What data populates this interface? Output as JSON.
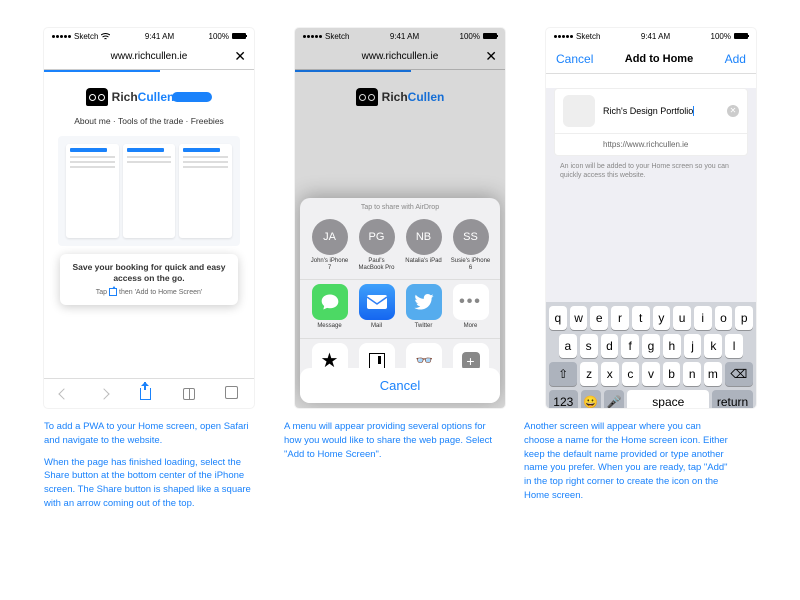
{
  "status": {
    "carrier": "Sketch",
    "time": "9:41 AM",
    "battery": "100%"
  },
  "url": "www.richcullen.ie",
  "phone1": {
    "logo_rich": "Rich",
    "logo_cullen": "Cullen",
    "nav": "About me · Tools of the trade · Freebies",
    "tooltip_title": "Save your booking for quick and easy access on the go.",
    "tooltip_sub_pre": "Tap",
    "tooltip_sub_post": "then 'Add to Home Screen'"
  },
  "phone2": {
    "airdrop": "Tap to share with AirDrop",
    "contacts": [
      {
        "initials": "JA",
        "name": "John's iPhone 7"
      },
      {
        "initials": "PG",
        "name": "Paul's MacBook Pro"
      },
      {
        "initials": "NB",
        "name": "Natalia's iPad"
      },
      {
        "initials": "SS",
        "name": "Susie's iPhone 6"
      }
    ],
    "apps": [
      {
        "label": "Message"
      },
      {
        "label": "Mail"
      },
      {
        "label": "Twitter"
      },
      {
        "label": "More"
      }
    ],
    "actions": [
      {
        "label": "Add to Favourites"
      },
      {
        "label": "Add Bookmark"
      },
      {
        "label": "Add to Reading List"
      },
      {
        "label": "Add to Home Screen"
      }
    ],
    "cancel": "Cancel"
  },
  "phone3": {
    "cancel": "Cancel",
    "title": "Add to Home",
    "add": "Add",
    "name_value": "Rich's Design Portfolio",
    "url_value": "https://www.richcullen.ie",
    "help": "An icon will be added to your Home screen so you can quickly access this website.",
    "keys_r1": [
      "q",
      "w",
      "e",
      "r",
      "t",
      "y",
      "u",
      "i",
      "o",
      "p"
    ],
    "keys_r2": [
      "a",
      "s",
      "d",
      "f",
      "g",
      "h",
      "j",
      "k",
      "l"
    ],
    "keys_r3": [
      "z",
      "x",
      "c",
      "v",
      "b",
      "n",
      "m"
    ],
    "shift": "⇧",
    "bksp": "⌫",
    "num": "123",
    "emoji": "😀",
    "mic": "🎤",
    "space": "space",
    "return": "return"
  },
  "captions": {
    "c1a": "To add a PWA to your Home screen, open Safari and navigate to the website.",
    "c1b": "When the page has finished loading, select the Share button at the bottom center of the iPhone screen. The Share button is shaped like a square with an arrow coming out of the top.",
    "c2": "A menu will appear providing several options for how you would like to share the web page. Select \"Add to Home Screen\".",
    "c3": "Another screen will appear where you can choose a name for the Home screen icon. Either keep the default name provided or type another name you prefer. When you are ready, tap \"Add\" in the top right corner to create the icon on the Home screen."
  }
}
